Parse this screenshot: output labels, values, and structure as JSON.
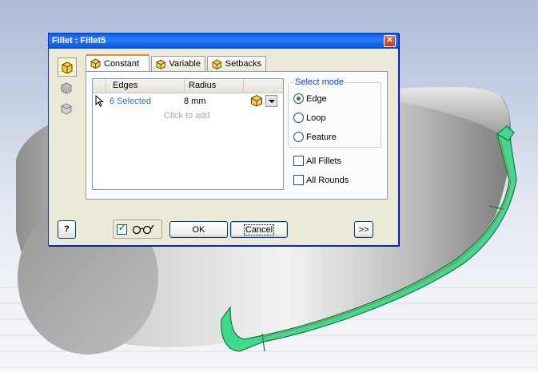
{
  "dialog": {
    "title": "Fillet : Fillet5",
    "close_glyph": "✕",
    "tabs": [
      {
        "label": "Constant",
        "active": true
      },
      {
        "label": "Variable",
        "active": false
      },
      {
        "label": "Setbacks",
        "active": false
      }
    ],
    "grid": {
      "columns": [
        "Edges",
        "Radius"
      ],
      "rows": [
        {
          "edges": "6 Selected",
          "radius": "8 mm"
        }
      ],
      "add_placeholder": "Click to add"
    },
    "select_mode": {
      "legend": "Select mode",
      "options": [
        {
          "label": "Edge",
          "selected": true
        },
        {
          "label": "Loop",
          "selected": false
        },
        {
          "label": "Feature",
          "selected": false
        }
      ]
    },
    "checkboxes": {
      "all_fillets": {
        "label": "All Fillets",
        "checked": false
      },
      "all_rounds": {
        "label": "All Rounds",
        "checked": false
      }
    },
    "buttons": {
      "help": "?",
      "ok": "OK",
      "cancel": "Cancel",
      "more": ">>"
    },
    "preview_checked": true
  },
  "colors": {
    "titlebar": "#0a5ee8",
    "selected_edge_text": "#3b6cc4",
    "fillet_highlight": "#3fd98f",
    "model_gray": "#d8d8d8"
  }
}
